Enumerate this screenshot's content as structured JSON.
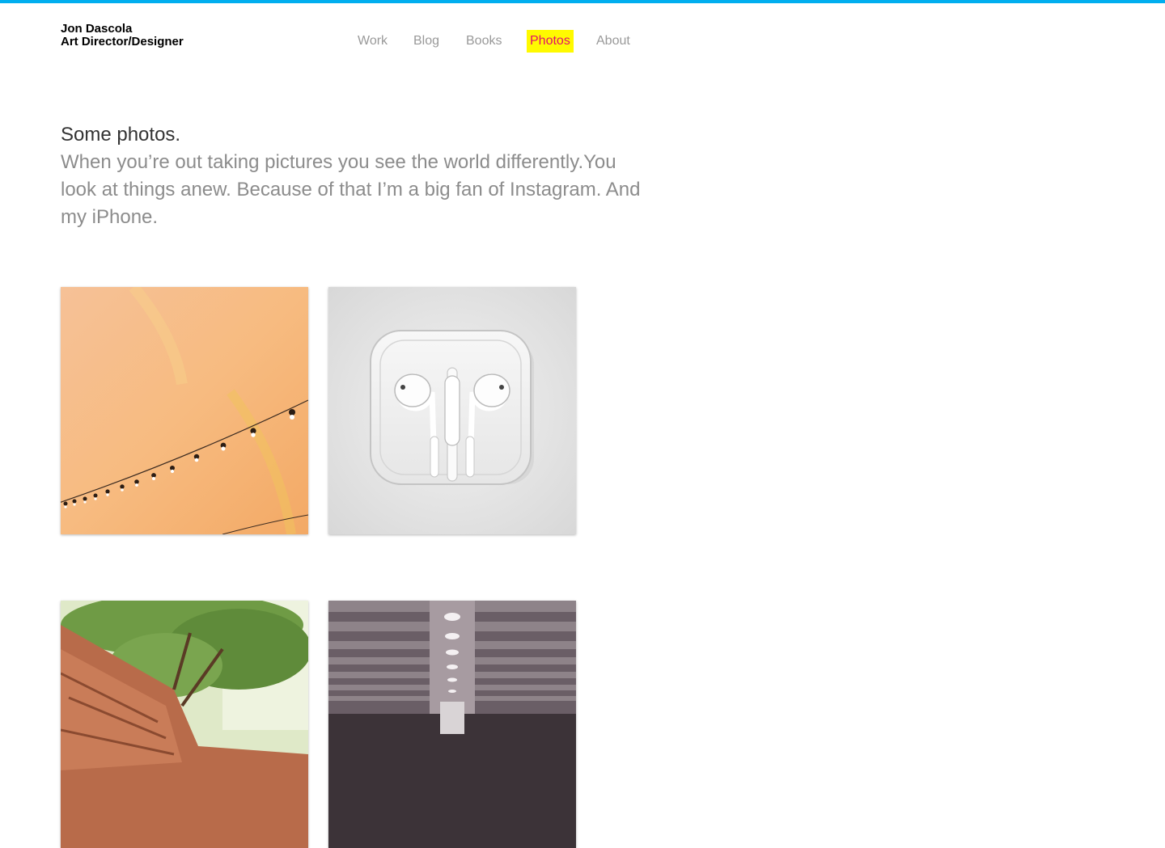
{
  "header": {
    "name": "Jon Dascola",
    "role": "Art Director/Designer"
  },
  "nav": {
    "items": [
      {
        "label": "Work",
        "active": false
      },
      {
        "label": "Blog",
        "active": false
      },
      {
        "label": "Books",
        "active": false
      },
      {
        "label": "Photos",
        "active": true
      },
      {
        "label": "About",
        "active": false
      }
    ]
  },
  "intro": {
    "lead": "Some photos.",
    "body": "When you’re out taking pictures you see the world differently.You look at things anew. Because of that I’m a big fan of Instagram. And my iPhone."
  },
  "photos": [
    {
      "subject": "string-lights-rainbow-photo"
    },
    {
      "subject": "earpods-case-photo"
    },
    {
      "subject": "redwood-tree-photo"
    },
    {
      "subject": "concrete-ceiling-photo"
    }
  ],
  "colors": {
    "accent_bar": "#00aeef",
    "nav_highlight": "#fffa00",
    "nav_active_text": "#e0106b",
    "nav_text": "#999999"
  }
}
